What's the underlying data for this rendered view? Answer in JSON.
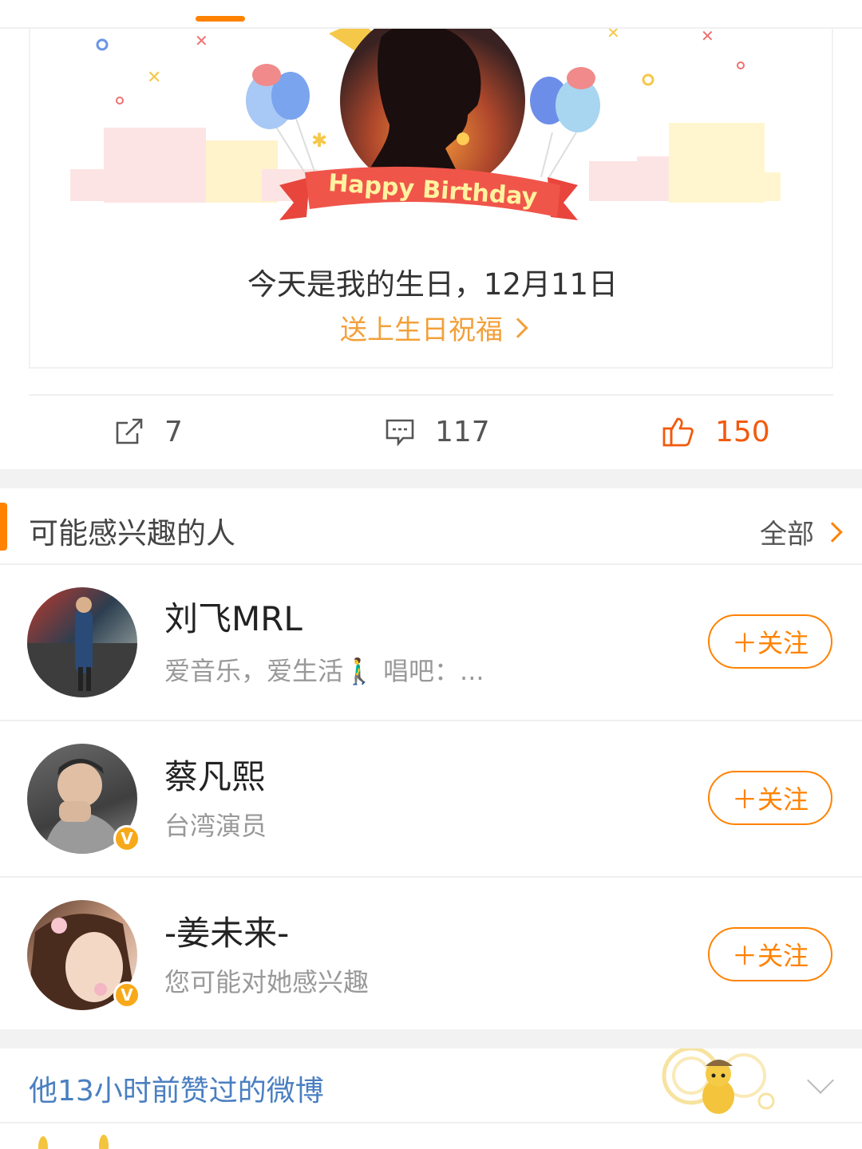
{
  "birthday_card": {
    "banner_text": "Happy Birthday",
    "message": "今天是我的生日，12月11日",
    "link": "送上生日祝福"
  },
  "actions": {
    "repost_count": "7",
    "comment_count": "117",
    "like_count": "150"
  },
  "people": {
    "title": "可能感兴趣的人",
    "all_label": "全部",
    "follow_label": "＋关注",
    "items": [
      {
        "name": "刘飞MRL",
        "desc": "爱音乐，爱生活🚶‍♂️ 唱吧：...",
        "verified": false
      },
      {
        "name": "蔡凡熙",
        "desc": "台湾演员",
        "verified": true
      },
      {
        "name": "-姜未来-",
        "desc": "您可能对她感兴趣",
        "verified": true
      }
    ]
  },
  "liked": {
    "title": "他13小时前赞过的微博"
  },
  "colors": {
    "accent": "#ff8200",
    "like": "#f25a0d",
    "link_blue": "#4a7fc1",
    "bday_link": "#f3a03a"
  }
}
